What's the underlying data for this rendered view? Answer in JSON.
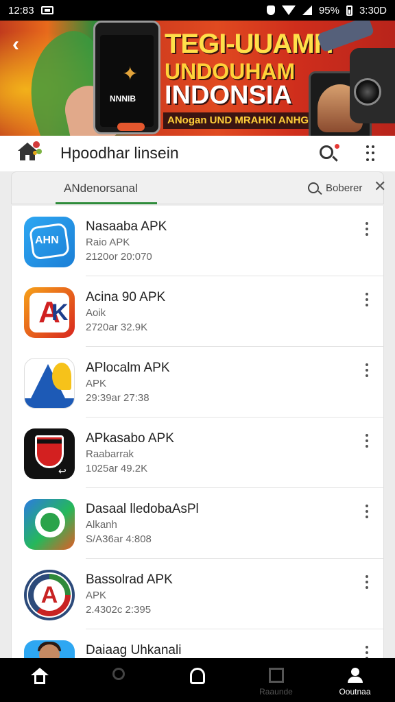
{
  "status_bar": {
    "time": "12:83",
    "battery_pct": "95%",
    "right_text": "3:30D"
  },
  "banner": {
    "line1": "TEGI-UUAMH",
    "line2": "UNDOUHAM",
    "line3": "INDONSIA",
    "subtitle": "ANogan UND MRAHKI ANHGO",
    "phone_text": "NNNIB"
  },
  "app_bar": {
    "title": "Hpoodhar linsein"
  },
  "search": {
    "value": "ANdenorsanal",
    "filter_label": "Boberer"
  },
  "apps": [
    {
      "name": "Nasaaba APK",
      "tag": "Raio APK",
      "meta": "2120or 20:070",
      "icon": "blue-scribble-app-icon"
    },
    {
      "name": "Acina 90 APK",
      "tag": "Aoik",
      "meta": "2720ar 32.9K",
      "icon": "red-ak-app-icon"
    },
    {
      "name": "APlocalm APK",
      "tag": "APK",
      "meta": "29:39ar 27:38",
      "icon": "blue-a-app-icon"
    },
    {
      "name": "APkasabo APK",
      "tag": "Raabarrak",
      "meta": "1025ar 49.2K",
      "icon": "red-shield-app-icon"
    },
    {
      "name": "Dasaal lledobaAsPl",
      "tag": "Alkanh",
      "meta": "S/A36ar 4:808",
      "icon": "green-chat-app-icon"
    },
    {
      "name": "Bassolrad APK",
      "tag": "APK",
      "meta": "2.4302c 2:395",
      "icon": "round-a-app-icon"
    },
    {
      "name": "Daiaag Uhkanali",
      "tag": "",
      "meta": "",
      "icon": "portrait-app-icon"
    }
  ],
  "bottom_nav": [
    {
      "label": "",
      "icon": "home-icon"
    },
    {
      "label": "",
      "icon": "search-icon"
    },
    {
      "label": "",
      "icon": "bell-icon"
    },
    {
      "label": "Raaunde",
      "icon": "box-icon"
    },
    {
      "label": "Ooutnaa",
      "icon": "user-icon"
    }
  ]
}
